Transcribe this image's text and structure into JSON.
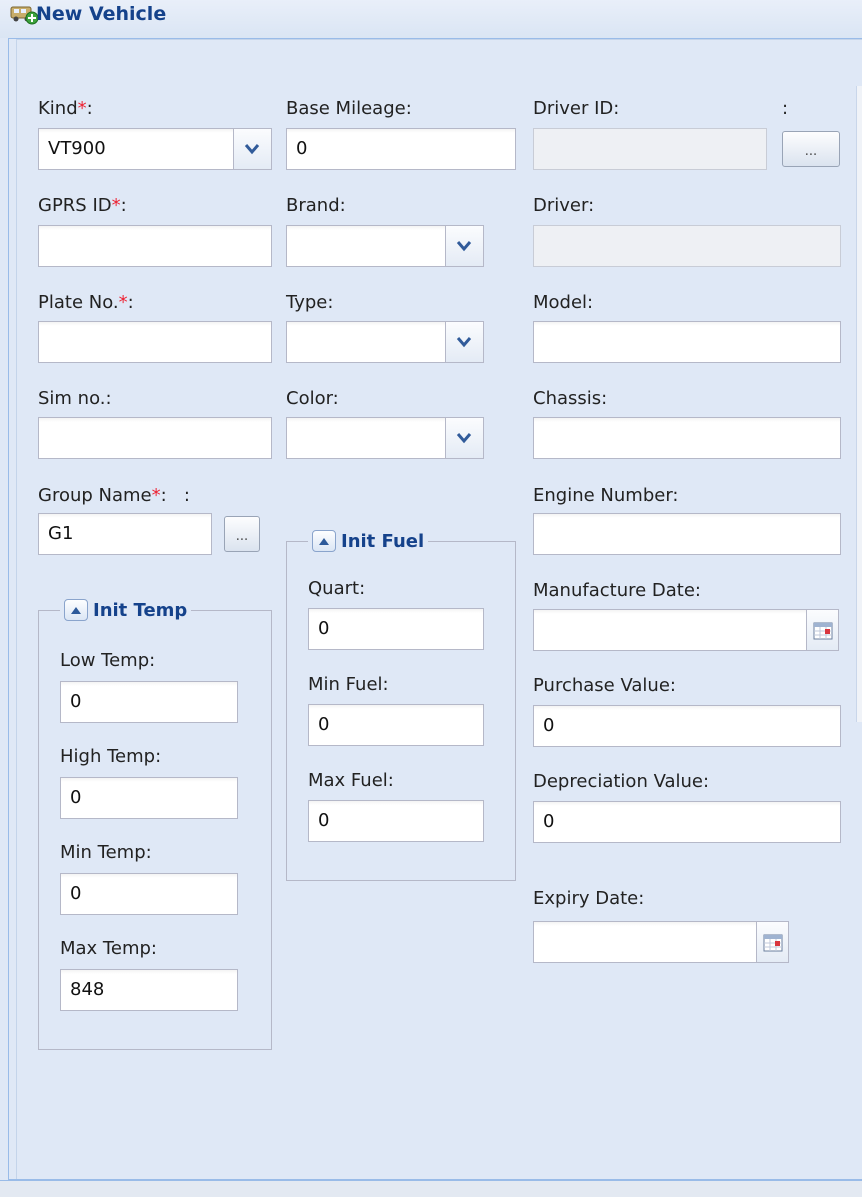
{
  "window": {
    "title": "New Vehicle",
    "icon": "vehicle-add-icon"
  },
  "colors": {
    "background": "#dfe8f6",
    "title": "#15428b",
    "required": "#ee2233",
    "border": "#b5b8c8"
  },
  "required_mark": "*",
  "form": {
    "kind": {
      "label": "Kind",
      "value": "VT900"
    },
    "base_mileage": {
      "label": "Base Mileage:",
      "value": "0"
    },
    "driver_id": {
      "label": "Driver ID:",
      "extra_label": ":",
      "value": "",
      "button": "..."
    },
    "gprs_id": {
      "label": "GPRS ID",
      "value": ""
    },
    "brand": {
      "label": "Brand:",
      "value": ""
    },
    "driver": {
      "label": "Driver:",
      "value": ""
    },
    "plate_no": {
      "label": "Plate No.",
      "value": ""
    },
    "type": {
      "label": "Type:",
      "value": ""
    },
    "model": {
      "label": "Model:",
      "value": ""
    },
    "sim_no": {
      "label": "Sim no.:",
      "value": ""
    },
    "color": {
      "label": "Color:",
      "value": ""
    },
    "chassis": {
      "label": "Chassis:",
      "value": ""
    },
    "group_name": {
      "label": "Group Name",
      "extra_label": ":",
      "value": "G1",
      "button": "..."
    },
    "engine_number": {
      "label": "Engine Number:",
      "value": ""
    },
    "manufacture_date": {
      "label": "Manufacture Date:",
      "value": ""
    },
    "purchase_value": {
      "label": "Purchase Value:",
      "value": "0"
    },
    "depreciation_value": {
      "label": "Depreciation Value:",
      "value": "0"
    },
    "expiry_date": {
      "label": "Expiry Date:",
      "value": ""
    }
  },
  "init_temp": {
    "legend": "Init Temp",
    "low_temp": {
      "label": "Low Temp:",
      "value": "0"
    },
    "high_temp": {
      "label": "High Temp:",
      "value": "0"
    },
    "min_temp": {
      "label": "Min Temp:",
      "value": "0"
    },
    "max_temp": {
      "label": "Max Temp:",
      "value": "848"
    }
  },
  "init_fuel": {
    "legend": "Init Fuel",
    "quart": {
      "label": "Quart:",
      "value": "0"
    },
    "min_fuel": {
      "label": "Min Fuel:",
      "value": "0"
    },
    "max_fuel": {
      "label": "Max Fuel:",
      "value": "0"
    }
  }
}
